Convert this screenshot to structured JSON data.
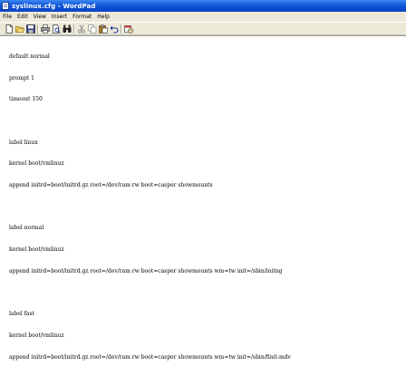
{
  "window": {
    "title": "syslinux.cfg - WordPad"
  },
  "menu": {
    "items": [
      "File",
      "Edit",
      "View",
      "Insert",
      "Format",
      "Help"
    ]
  },
  "toolbar": {
    "buttons": [
      "new-document-icon",
      "open-folder-icon",
      "save-icon",
      "print-icon",
      "print-preview-icon",
      "find-icon",
      "cut-icon",
      "copy-icon",
      "paste-icon",
      "undo-icon",
      "date-time-icon"
    ]
  },
  "document": {
    "lines": [
      "default normal",
      "prompt 1",
      "timeout 150",
      "",
      "label linux",
      "kernel boot/vmlinuz",
      "append initrd=boot/initrd.gz root=/dev/ram rw boot=casper showmounts",
      "",
      "label normal",
      "kernel boot/vmlinuz",
      "append initrd=boot/initrd.gz root=/dev/ram rw boot=casper showmounts wm=tw init=/sbin/initng",
      "",
      "label fast",
      "kernel boot/vmlinuz",
      "append initrd=boot/initrd.gz root=/dev/ram rw boot=casper showmounts wm=tw init=/sbin/finit-mdv"
    ]
  },
  "colors": {
    "titlebar": "#0a4bd2",
    "chrome": "#ece9d8",
    "document_background": "#ffffff"
  }
}
